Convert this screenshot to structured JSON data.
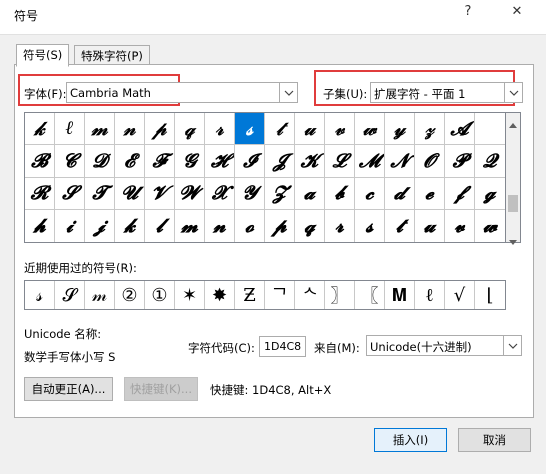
{
  "window": {
    "title": "符号",
    "help_label": "?",
    "close_label": "✕"
  },
  "tabs": [
    {
      "label": "符号(S)"
    },
    {
      "label": "特殊字符(P)"
    }
  ],
  "font": {
    "label": "字体(F):",
    "value": "Cambria Math"
  },
  "subset": {
    "label": "子集(U):",
    "value": "扩展字符 - 平面 1"
  },
  "symbol_grid": {
    "rows": [
      [
        "𝓀",
        "ℓ",
        "𝓂",
        "𝓃",
        "𝓅",
        "𝓆",
        "𝓇",
        "𝓈",
        "𝓉",
        "𝓊",
        "𝓋",
        "𝓌",
        "𝓎",
        "𝓏",
        "𝓐",
        ""
      ],
      [
        "𝓑",
        "𝓒",
        "𝓓",
        "𝓔",
        "𝓕",
        "𝓖",
        "𝓗",
        "𝓘",
        "𝓙",
        "𝓚",
        "𝓛",
        "𝓜",
        "𝓝",
        "𝓞",
        "𝓟",
        "𝓠"
      ],
      [
        "𝓡",
        "𝓢",
        "𝓣",
        "𝓤",
        "𝓥",
        "𝓦",
        "𝓧",
        "𝓨",
        "𝓩",
        "𝓪",
        "𝓫",
        "𝓬",
        "𝓭",
        "𝓮",
        "𝓯",
        "𝓰"
      ],
      [
        "𝓱",
        "𝓲",
        "𝓳",
        "𝓴",
        "𝓵",
        "𝓶",
        "𝓷",
        "𝓸",
        "𝓹",
        "𝓺",
        "𝓻",
        "𝓼",
        "𝓽",
        "𝓾",
        "𝓿",
        "𝔀"
      ]
    ],
    "selected_row": 0,
    "selected_col": 7,
    "selected_color": "#0078d7"
  },
  "recent": {
    "label": "近期使用过的符号(R):",
    "symbols": [
      "𝓈",
      "𝓢",
      "𝓂",
      "②",
      "①",
      "✶",
      "✸",
      "Ƶ",
      "ᄀ",
      "ᄾ",
      "〗",
      "〖",
      "𝐌",
      "ℓ",
      "√",
      "⌊"
    ]
  },
  "unicode_name_label": "Unicode 名称:",
  "unicode_name_value": "数学手写体小写 S",
  "char_code": {
    "label": "字符代码(C):",
    "value": "1D4C8"
  },
  "from": {
    "label": "来自(M):",
    "value": "Unicode(十六进制)"
  },
  "autocorrect_button": "自动更正(A)...",
  "shortcut_button": "快捷键(K)...",
  "shortcut_text": "快捷键: 1D4C8, Alt+X",
  "insert_button": "插入(I)",
  "cancel_button": "取消",
  "colors": {
    "highlight_box": "#e03c3c",
    "accent": "#0078d7"
  }
}
